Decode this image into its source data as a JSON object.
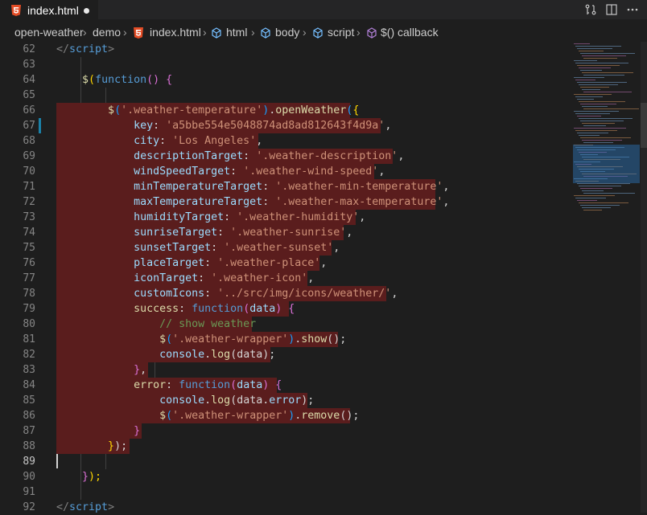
{
  "tab": {
    "title": "index.html"
  },
  "breadcrumbs": [
    "open-weather",
    "demo",
    "index.html",
    "html",
    "body",
    "script",
    "$() callback"
  ],
  "icons": {
    "html_file": "html5-file-icon",
    "element": "element-cube-icon",
    "method": "method-cube-icon",
    "compare": "git-compare-icon",
    "split": "split-editor-icon",
    "more": "more-actions-icon"
  },
  "line_numbers": [
    "62",
    "63",
    "64",
    "65",
    "66",
    "67",
    "68",
    "69",
    "70",
    "71",
    "72",
    "73",
    "74",
    "75",
    "76",
    "77",
    "78",
    "79",
    "80",
    "81",
    "82",
    "83",
    "84",
    "85",
    "86",
    "87",
    "88",
    "89",
    "90",
    "91",
    "92"
  ],
  "code": [
    [
      {
        "t": "</",
        "c": "tg2"
      },
      {
        "t": "script",
        "c": "tag"
      },
      {
        "t": ">",
        "c": "tg2"
      }
    ],
    [],
    [
      {
        "t": "    ",
        "c": "t"
      },
      {
        "t": "$",
        "c": "f"
      },
      {
        "t": "(",
        "c": "b1"
      },
      {
        "t": "function",
        "c": "tag"
      },
      {
        "t": "() {",
        "c": "b2"
      }
    ],
    [],
    [
      {
        "t": "        ",
        "c": "t"
      },
      {
        "t": "$",
        "c": "f"
      },
      {
        "t": "(",
        "c": "b3"
      },
      {
        "t": "'.weather-temperature'",
        "c": "s"
      },
      {
        "t": ")",
        "c": "b3"
      },
      {
        "t": ".",
        "c": "t"
      },
      {
        "t": "openWeather",
        "c": "f"
      },
      {
        "t": "(",
        "c": "b3"
      },
      {
        "t": "{",
        "c": "b1"
      }
    ],
    [
      {
        "t": "            ",
        "c": "t"
      },
      {
        "t": "key",
        "c": "p"
      },
      {
        "t": ": ",
        "c": "t"
      },
      {
        "t": "'a5bbe554e5048874ad8ad812643f4d9a'",
        "c": "s"
      },
      {
        "t": ",",
        "c": "t"
      }
    ],
    [
      {
        "t": "            ",
        "c": "t"
      },
      {
        "t": "city",
        "c": "p"
      },
      {
        "t": ": ",
        "c": "t"
      },
      {
        "t": "'Los Angeles'",
        "c": "s"
      },
      {
        "t": ",",
        "c": "t"
      }
    ],
    [
      {
        "t": "            ",
        "c": "t"
      },
      {
        "t": "descriptionTarget",
        "c": "p"
      },
      {
        "t": ": ",
        "c": "t"
      },
      {
        "t": "'.weather-description'",
        "c": "s"
      },
      {
        "t": ",",
        "c": "t"
      }
    ],
    [
      {
        "t": "            ",
        "c": "t"
      },
      {
        "t": "windSpeedTarget",
        "c": "p"
      },
      {
        "t": ": ",
        "c": "t"
      },
      {
        "t": "'.weather-wind-speed'",
        "c": "s"
      },
      {
        "t": ",",
        "c": "t"
      }
    ],
    [
      {
        "t": "            ",
        "c": "t"
      },
      {
        "t": "minTemperatureTarget",
        "c": "p"
      },
      {
        "t": ": ",
        "c": "t"
      },
      {
        "t": "'.weather-min-temperature'",
        "c": "s"
      },
      {
        "t": ",",
        "c": "t"
      }
    ],
    [
      {
        "t": "            ",
        "c": "t"
      },
      {
        "t": "maxTemperatureTarget",
        "c": "p"
      },
      {
        "t": ": ",
        "c": "t"
      },
      {
        "t": "'.weather-max-temperature'",
        "c": "s"
      },
      {
        "t": ",",
        "c": "t"
      }
    ],
    [
      {
        "t": "            ",
        "c": "t"
      },
      {
        "t": "humidityTarget",
        "c": "p"
      },
      {
        "t": ": ",
        "c": "t"
      },
      {
        "t": "'.weather-humidity'",
        "c": "s"
      },
      {
        "t": ",",
        "c": "t"
      }
    ],
    [
      {
        "t": "            ",
        "c": "t"
      },
      {
        "t": "sunriseTarget",
        "c": "p"
      },
      {
        "t": ": ",
        "c": "t"
      },
      {
        "t": "'.weather-sunrise'",
        "c": "s"
      },
      {
        "t": ",",
        "c": "t"
      }
    ],
    [
      {
        "t": "            ",
        "c": "t"
      },
      {
        "t": "sunsetTarget",
        "c": "p"
      },
      {
        "t": ": ",
        "c": "t"
      },
      {
        "t": "'.weather-sunset'",
        "c": "s"
      },
      {
        "t": ",",
        "c": "t"
      }
    ],
    [
      {
        "t": "            ",
        "c": "t"
      },
      {
        "t": "placeTarget",
        "c": "p"
      },
      {
        "t": ": ",
        "c": "t"
      },
      {
        "t": "'.weather-place'",
        "c": "s"
      },
      {
        "t": ",",
        "c": "t"
      }
    ],
    [
      {
        "t": "            ",
        "c": "t"
      },
      {
        "t": "iconTarget",
        "c": "p"
      },
      {
        "t": ": ",
        "c": "t"
      },
      {
        "t": "'.weather-icon'",
        "c": "s"
      },
      {
        "t": ",",
        "c": "t"
      }
    ],
    [
      {
        "t": "            ",
        "c": "t"
      },
      {
        "t": "customIcons",
        "c": "p"
      },
      {
        "t": ": ",
        "c": "t"
      },
      {
        "t": "'../src/img/icons/weather/'",
        "c": "s"
      },
      {
        "t": ",",
        "c": "t"
      }
    ],
    [
      {
        "t": "            ",
        "c": "t"
      },
      {
        "t": "success",
        "c": "f"
      },
      {
        "t": ": ",
        "c": "t"
      },
      {
        "t": "function",
        "c": "tag"
      },
      {
        "t": "(",
        "c": "b2"
      },
      {
        "t": "data",
        "c": "p"
      },
      {
        "t": ") {",
        "c": "b2"
      }
    ],
    [
      {
        "t": "                ",
        "c": "t"
      },
      {
        "t": "// show weather",
        "c": "c"
      }
    ],
    [
      {
        "t": "                ",
        "c": "t"
      },
      {
        "t": "$",
        "c": "f"
      },
      {
        "t": "(",
        "c": "b3"
      },
      {
        "t": "'.weather-wrapper'",
        "c": "s"
      },
      {
        "t": ")",
        "c": "b3"
      },
      {
        "t": ".",
        "c": "t"
      },
      {
        "t": "show",
        "c": "f"
      },
      {
        "t": "();",
        "c": "t"
      }
    ],
    [
      {
        "t": "                ",
        "c": "t"
      },
      {
        "t": "console",
        "c": "p"
      },
      {
        "t": ".",
        "c": "t"
      },
      {
        "t": "log",
        "c": "f"
      },
      {
        "t": "(data);",
        "c": "t"
      }
    ],
    [
      {
        "t": "            ",
        "c": "t"
      },
      {
        "t": "}",
        "c": "b2"
      },
      {
        "t": ",",
        "c": "t"
      }
    ],
    [
      {
        "t": "            ",
        "c": "t"
      },
      {
        "t": "error",
        "c": "f"
      },
      {
        "t": ": ",
        "c": "t"
      },
      {
        "t": "function",
        "c": "tag"
      },
      {
        "t": "(",
        "c": "b2"
      },
      {
        "t": "data",
        "c": "p"
      },
      {
        "t": ") {",
        "c": "b2"
      }
    ],
    [
      {
        "t": "                ",
        "c": "t"
      },
      {
        "t": "console",
        "c": "p"
      },
      {
        "t": ".",
        "c": "t"
      },
      {
        "t": "log",
        "c": "f"
      },
      {
        "t": "(data.",
        "c": "t"
      },
      {
        "t": "error",
        "c": "p"
      },
      {
        "t": ");",
        "c": "t"
      }
    ],
    [
      {
        "t": "                ",
        "c": "t"
      },
      {
        "t": "$",
        "c": "f"
      },
      {
        "t": "(",
        "c": "b3"
      },
      {
        "t": "'.weather-wrapper'",
        "c": "s"
      },
      {
        "t": ")",
        "c": "b3"
      },
      {
        "t": ".",
        "c": "t"
      },
      {
        "t": "remove",
        "c": "f"
      },
      {
        "t": "();",
        "c": "t"
      }
    ],
    [
      {
        "t": "            ",
        "c": "t"
      },
      {
        "t": "}",
        "c": "b2"
      }
    ],
    [
      {
        "t": "        ",
        "c": "t"
      },
      {
        "t": "}",
        "c": "b1"
      },
      {
        "t": ");",
        "c": "t"
      }
    ],
    [],
    [
      {
        "t": "    ",
        "c": "t"
      },
      {
        "t": "}",
        "c": "b2"
      },
      {
        "t": ");",
        "c": "b1"
      }
    ],
    [],
    [
      {
        "t": "</",
        "c": "tg2"
      },
      {
        "t": "script",
        "c": "tag"
      },
      {
        "t": ">",
        "c": "tg2"
      }
    ]
  ],
  "active_line": "89",
  "colors": {
    "selection": "#5a1d1d",
    "editor_bg": "#1e1e1e",
    "tab_bar": "#252526"
  }
}
